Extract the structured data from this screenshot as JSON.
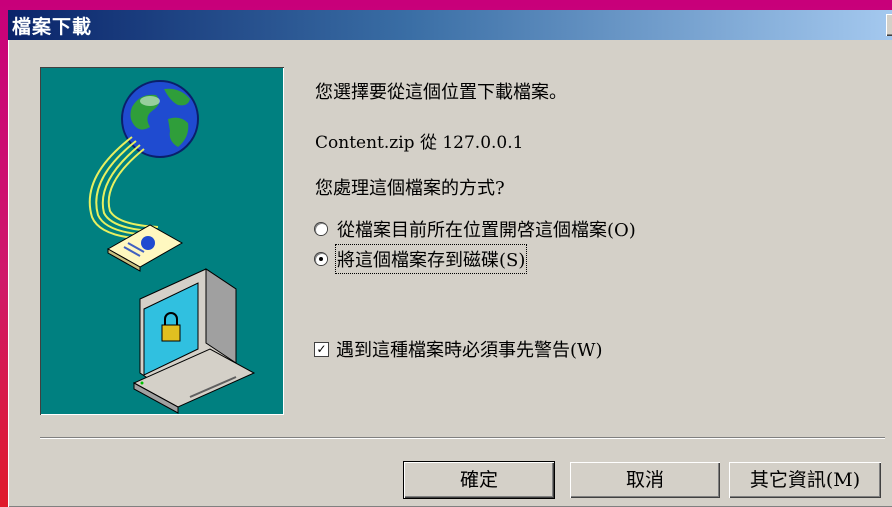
{
  "window": {
    "title": "檔案下載",
    "close_glyph": "×"
  },
  "messages": {
    "intro": "您選擇要從這個位置下載檔案。",
    "source": "Content.zip 從 127.0.0.1",
    "question": "您處理這個檔案的方式?"
  },
  "options": {
    "open_from_location": "從檔案目前所在位置開啓這個檔案(O)",
    "save_to_disk": "將這個檔案存到磁碟(S)",
    "selected": "save_to_disk"
  },
  "checkbox": {
    "label": "遇到這種檔案時必須事先警告(W)",
    "checked": true,
    "check_glyph": "✓"
  },
  "buttons": {
    "ok": "確定",
    "cancel": "取消",
    "more_info": "其它資訊(M)"
  },
  "icons": {
    "illustration": "download-computer-globe-icon"
  },
  "colors": {
    "title_bar_start": "#0a246a",
    "title_bar_end": "#a6caf0",
    "dialog_face": "#d4d0c8",
    "illustration_bg": "#008080"
  }
}
